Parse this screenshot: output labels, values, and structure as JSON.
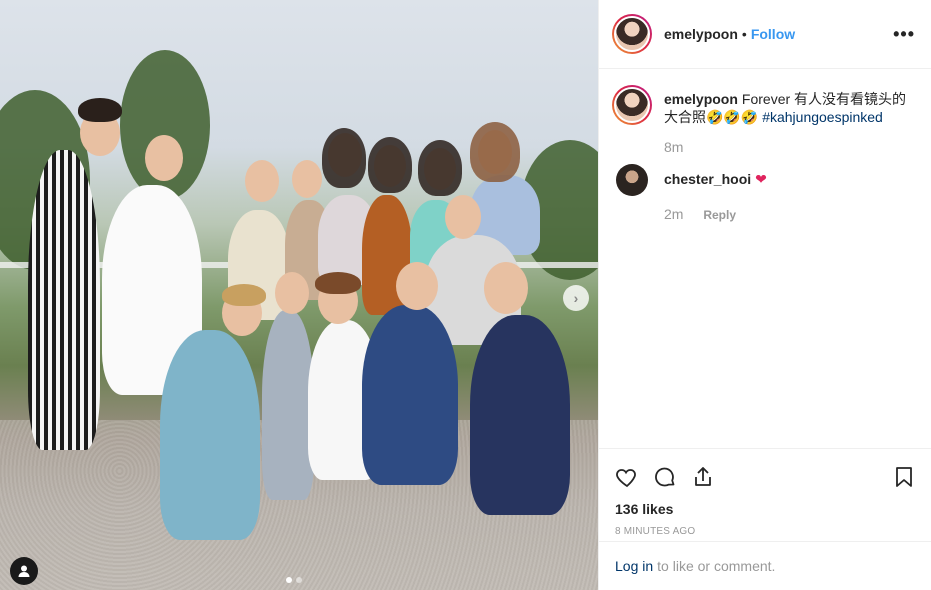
{
  "post": {
    "owner": "emelypoon",
    "separator": "•",
    "follow_label": "Follow",
    "more_label": "•••"
  },
  "caption": {
    "username": "emelypoon",
    "text": "Forever 有人没有看镜头的大合照🤣🤣🤣",
    "hashtag": "#kahjungoespinked",
    "age": "8m"
  },
  "comments": [
    {
      "username": "chester_hooi",
      "text": "❤",
      "age": "2m",
      "reply_label": "Reply"
    }
  ],
  "actions": {
    "likes": "136 likes",
    "timestamp": "8 minutes ago",
    "icons": [
      "heart-icon",
      "comment-icon",
      "share-icon",
      "bookmark-icon"
    ]
  },
  "login": {
    "link": "Log in",
    "rest": "to like or comment."
  },
  "media": {
    "carousel_current": 1,
    "carousel_total": 2,
    "icons": [
      "next-arrow-icon",
      "tagged-user-icon"
    ]
  }
}
